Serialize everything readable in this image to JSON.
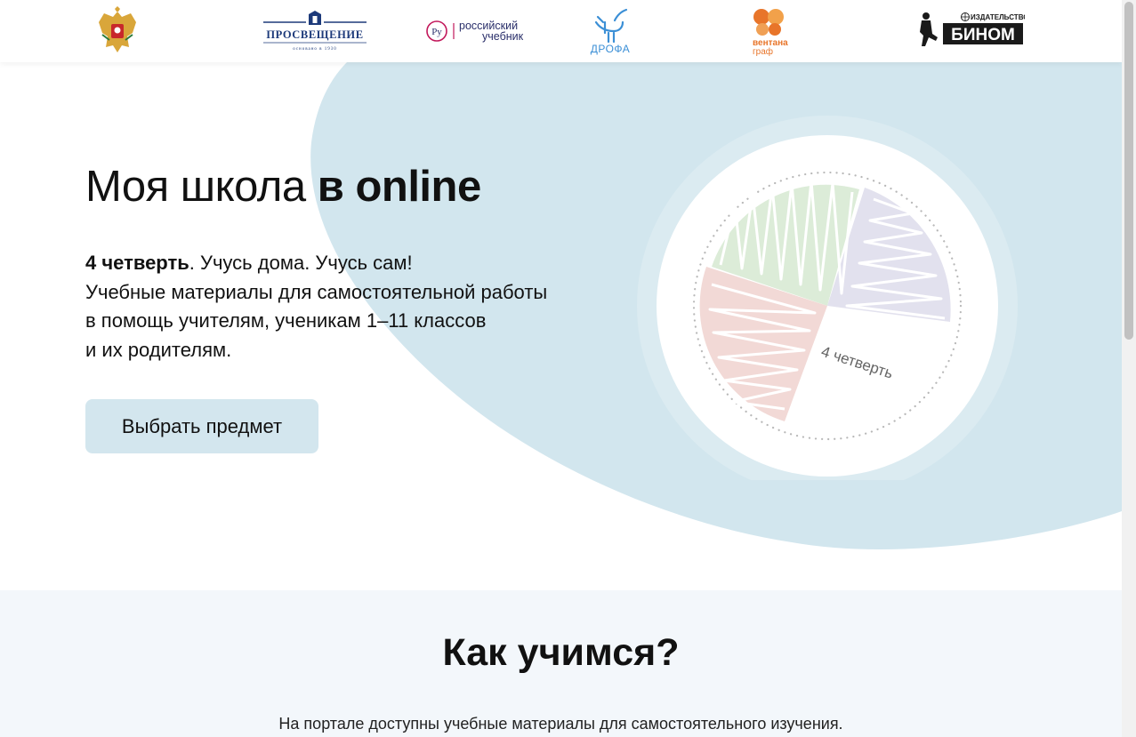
{
  "header": {
    "logos": [
      {
        "name": "coat-of-arms",
        "label": ""
      },
      {
        "name": "prosveshchenie",
        "label": "ПРОСВЕЩЕНИЕ",
        "sublabel": "основано в 1930"
      },
      {
        "name": "russian-textbook",
        "label_line1": "российский",
        "label_line2": "учебник"
      },
      {
        "name": "drofa",
        "label": "ДРОФА"
      },
      {
        "name": "ventana-graf",
        "label_line1": "вентана",
        "label_line2": "граф"
      },
      {
        "name": "binom",
        "label_top": "ИЗДАТЕЛЬСТВО",
        "label": "БИНОМ"
      }
    ]
  },
  "hero": {
    "title_regular": "Моя школа",
    "title_bold": "в online",
    "lead_bold": "4 четверть",
    "lead_rest": ". Учусь дома. Учусь сам!",
    "lines": [
      "Учебные материалы для самостоятельной работы",
      "в помощь учителям, ученикам 1–11 классов",
      "и их родителям."
    ],
    "button_label": "Выбрать предмет",
    "illustration_label": "4 четверть"
  },
  "how": {
    "title": "Как учимся?",
    "text": "На портале доступны учебные материалы для самостоятельного изучения."
  },
  "colors": {
    "blob": "#d2e6ee",
    "button": "#d3e6ee",
    "ring": "#dbebf1",
    "quarter_green": "#dcecd8",
    "quarter_purple": "#e2e1ee",
    "quarter_red": "#f2d9d6",
    "section_bg": "#f3f7fb"
  }
}
